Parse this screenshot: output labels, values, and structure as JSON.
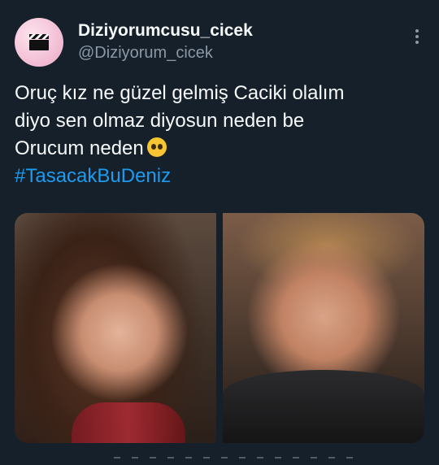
{
  "tweet": {
    "display_name": "Diziyorumcusu_cicek",
    "handle": "@Diziyorum_cicek",
    "text_lines": [
      "Oruç kız ne güzel gelmiş Caciki olalım",
      "diyo sen olmaz diyosun neden be",
      "Orucum neden"
    ],
    "emoji": "pleading-face",
    "hashtag": "#TasacakBuDeniz"
  },
  "media": {
    "images": [
      {
        "subject": "woman-smiling"
      },
      {
        "subject": "man-speaking"
      }
    ]
  },
  "colors": {
    "background": "#15202b",
    "text": "#f7f9f9",
    "secondary": "#8b98a5",
    "link": "#1d9bf0",
    "avatar": "#f6c9dc"
  }
}
